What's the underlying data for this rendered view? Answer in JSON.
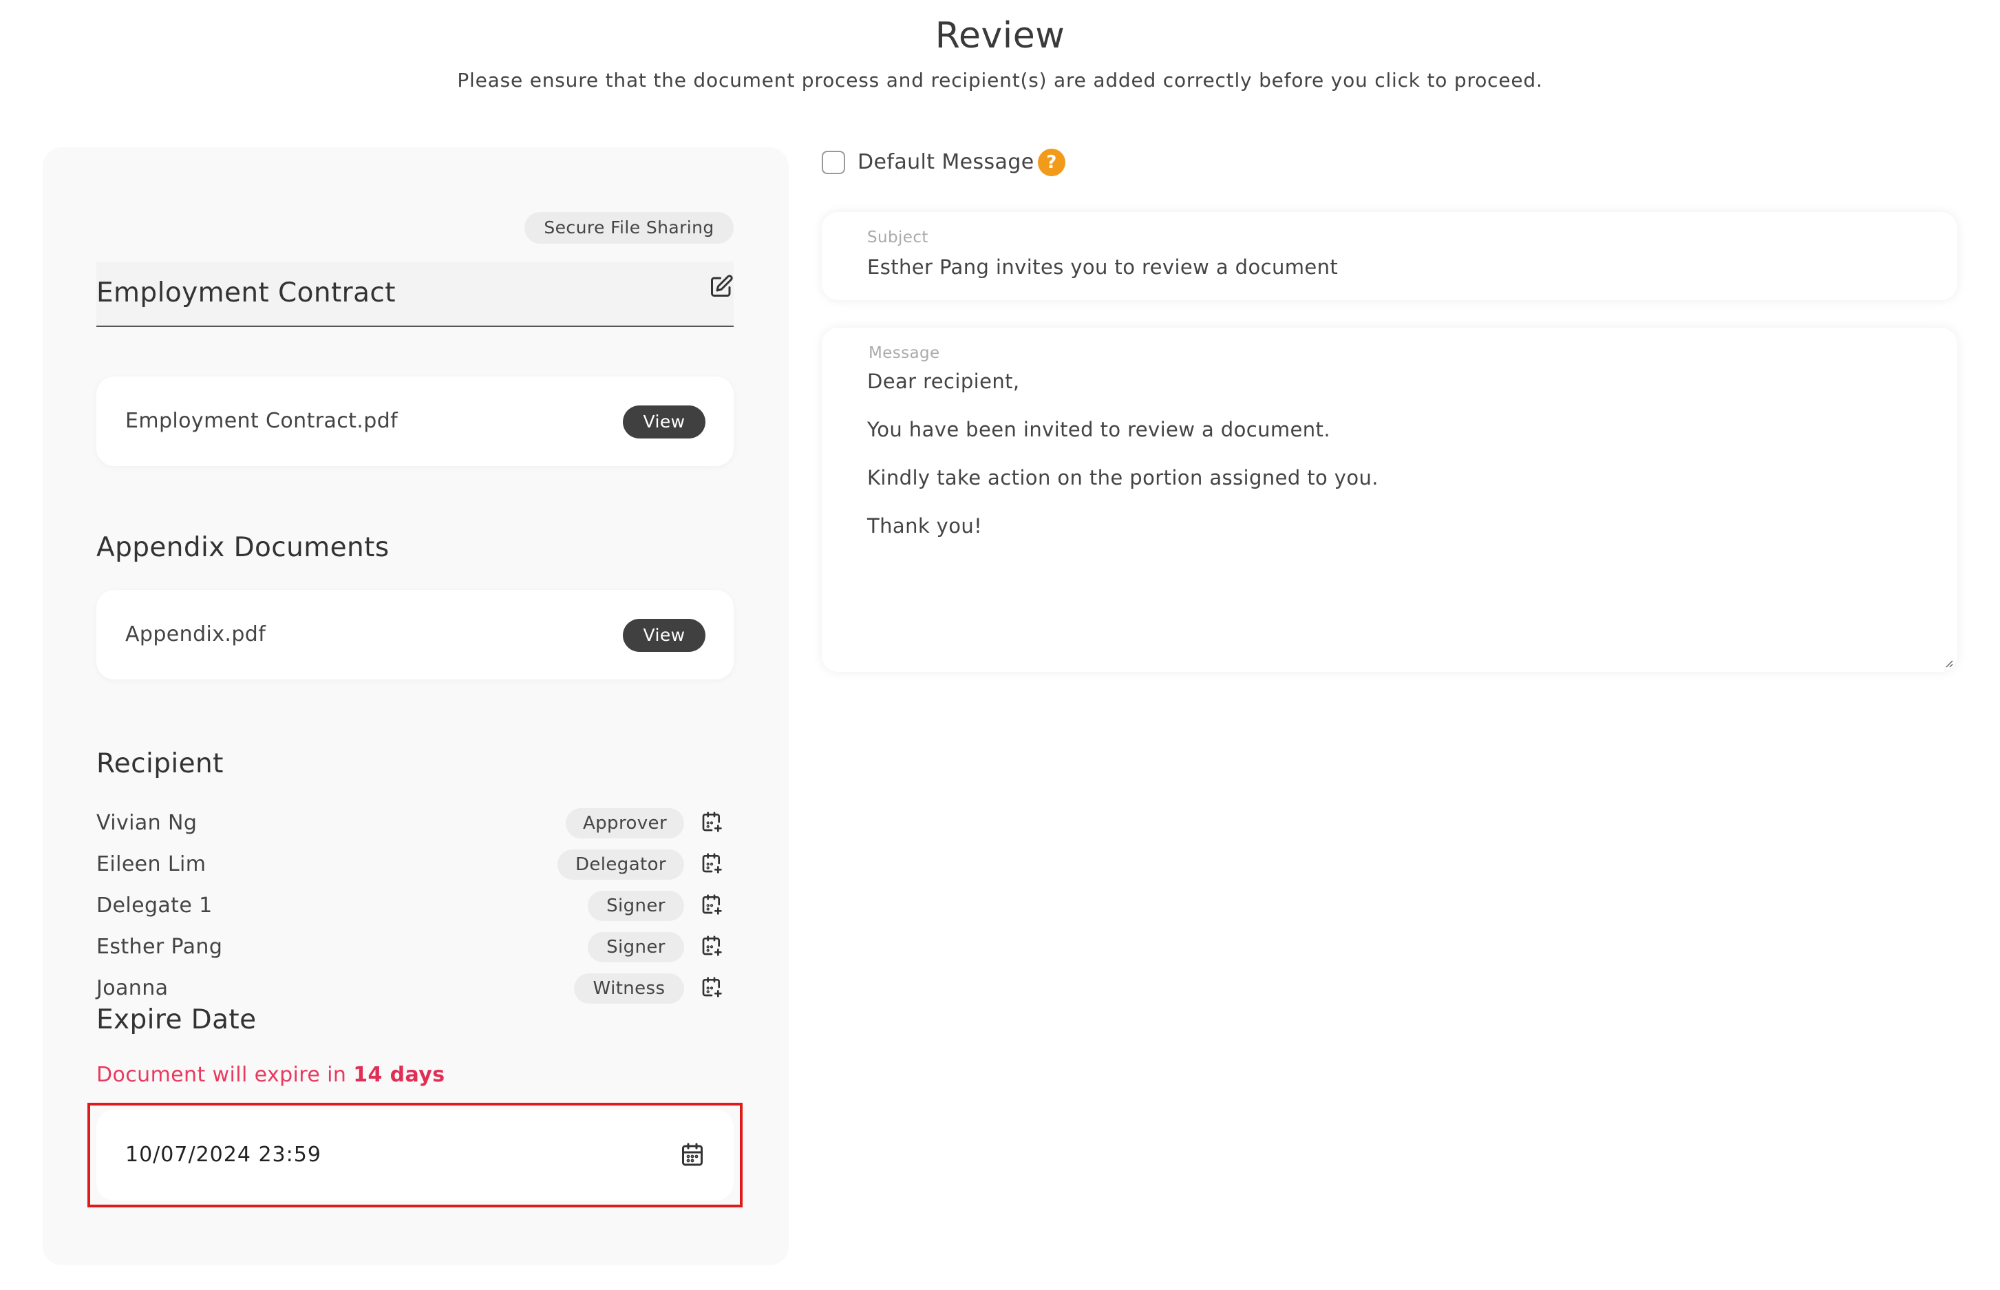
{
  "header": {
    "title": "Review",
    "subtitle": "Please ensure that the document process and recipient(s) are added correctly before you click to proceed."
  },
  "document": {
    "badge": "Secure File Sharing",
    "title": "Employment Contract",
    "file": {
      "name": "Employment Contract.pdf",
      "view_label": "View"
    }
  },
  "appendix": {
    "heading": "Appendix Documents",
    "file": {
      "name": "Appendix.pdf",
      "view_label": "View"
    }
  },
  "recipients": {
    "heading": "Recipient",
    "items": [
      {
        "name": "Vivian Ng",
        "role": "Approver"
      },
      {
        "name": "Eileen Lim",
        "role": "Delegator"
      },
      {
        "name": "Delegate 1",
        "role": "Signer"
      },
      {
        "name": "Esther Pang",
        "role": "Signer"
      },
      {
        "name": "Joanna",
        "role": "Witness"
      }
    ]
  },
  "expire": {
    "heading": "Expire Date",
    "notice_prefix": "Document will expire in ",
    "notice_days": "14 days",
    "date_value": "10/07/2024 23:59"
  },
  "email": {
    "default_message_label": "Default Message",
    "help_symbol": "?",
    "subject_label": "Subject",
    "subject_value": "Esther Pang invites you to review a document",
    "message_label": "Message",
    "message_lines": [
      "Dear recipient,",
      "You have been invited to review a document.",
      "Kindly take action on the portion assigned to you.",
      "Thank you!"
    ]
  },
  "colors": {
    "accent_help": "#f29a1a",
    "expire_text": "#e8395f",
    "highlight_border": "#e01a1a",
    "view_button": "#404040"
  }
}
